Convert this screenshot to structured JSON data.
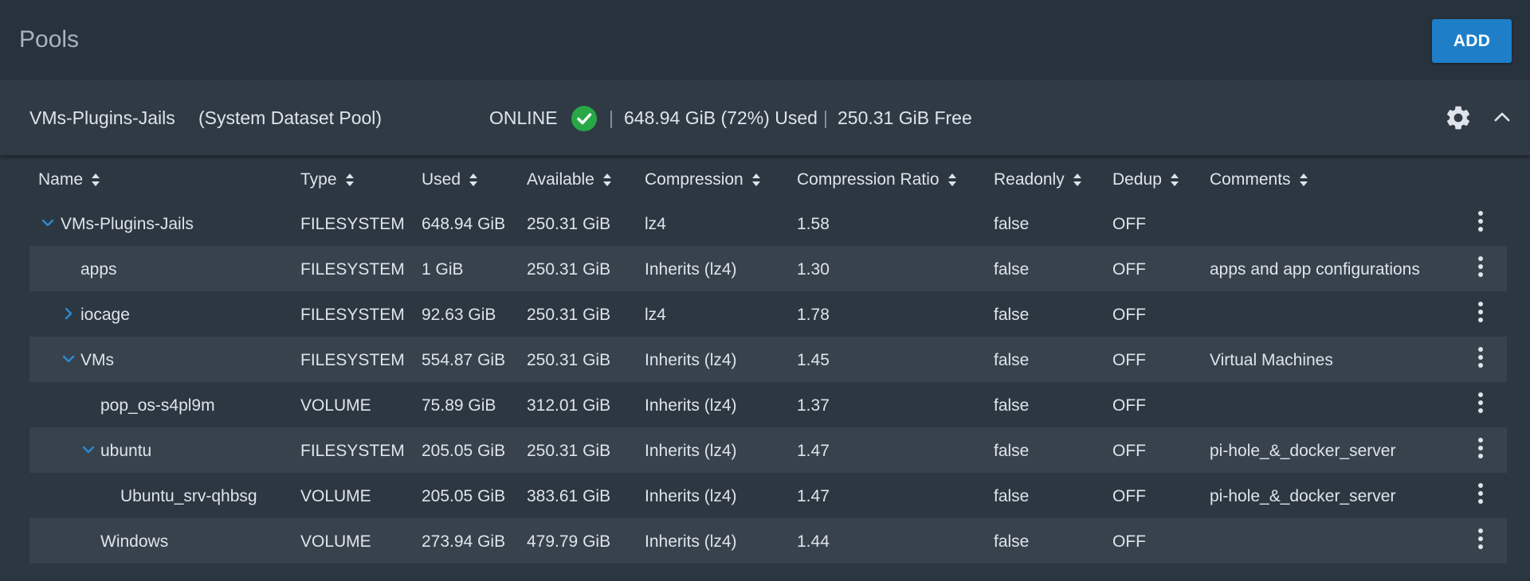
{
  "page": {
    "title": "Pools",
    "add_label": "ADD"
  },
  "pool": {
    "name": "VMs-Plugins-Jails",
    "subtitle": "(System Dataset Pool)",
    "status": "ONLINE",
    "used": "648.94 GiB (72%) Used",
    "free": "250.31 GiB Free",
    "separator": "|",
    "status_color": "#27a745",
    "icons": [
      "check-icon",
      "gear-icon",
      "chevron-up-icon"
    ]
  },
  "table": {
    "columns": [
      "Name",
      "Type",
      "Used",
      "Available",
      "Compression",
      "Compression Ratio",
      "Readonly",
      "Dedup",
      "Comments"
    ],
    "rows": [
      {
        "name": "VMs-Plugins-Jails",
        "type": "FILESYSTEM",
        "used": "648.94 GiB",
        "available": "250.31 GiB",
        "compression": "lz4",
        "ratio": "1.58",
        "readonly": "false",
        "dedup": "OFF",
        "comments": "",
        "expander": "expanded"
      },
      {
        "name": "apps",
        "type": "FILESYSTEM",
        "used": "1 GiB",
        "available": "250.31 GiB",
        "compression": "Inherits (lz4)",
        "ratio": "1.30",
        "readonly": "false",
        "dedup": "OFF",
        "comments": "apps and app configurations",
        "expander": "none"
      },
      {
        "name": "iocage",
        "type": "FILESYSTEM",
        "used": "92.63 GiB",
        "available": "250.31 GiB",
        "compression": "lz4",
        "ratio": "1.78",
        "readonly": "false",
        "dedup": "OFF",
        "comments": "",
        "expander": "collapsed"
      },
      {
        "name": "VMs",
        "type": "FILESYSTEM",
        "used": "554.87 GiB",
        "available": "250.31 GiB",
        "compression": "Inherits (lz4)",
        "ratio": "1.45",
        "readonly": "false",
        "dedup": "OFF",
        "comments": "Virtual Machines",
        "expander": "expanded"
      },
      {
        "name": "pop_os-s4pl9m",
        "type": "VOLUME",
        "used": "75.89 GiB",
        "available": "312.01 GiB",
        "compression": "Inherits (lz4)",
        "ratio": "1.37",
        "readonly": "false",
        "dedup": "OFF",
        "comments": "",
        "expander": "none"
      },
      {
        "name": "ubuntu",
        "type": "FILESYSTEM",
        "used": "205.05 GiB",
        "available": "250.31 GiB",
        "compression": "Inherits (lz4)",
        "ratio": "1.47",
        "readonly": "false",
        "dedup": "OFF",
        "comments": "pi-hole_&_docker_server",
        "expander": "expanded"
      },
      {
        "name": "Ubuntu_srv-qhbsg",
        "type": "VOLUME",
        "used": "205.05 GiB",
        "available": "383.61 GiB",
        "compression": "Inherits (lz4)",
        "ratio": "1.47",
        "readonly": "false",
        "dedup": "OFF",
        "comments": "pi-hole_&_docker_server",
        "expander": "none"
      },
      {
        "name": "Windows",
        "type": "VOLUME",
        "used": "273.94 GiB",
        "available": "479.79 GiB",
        "compression": "Inherits (lz4)",
        "ratio": "1.44",
        "readonly": "false",
        "dedup": "OFF",
        "comments": "",
        "expander": "none"
      }
    ]
  },
  "colors": {
    "accent": "#1e7fc8",
    "expander": "#2a8bd6",
    "row_alt": "#37424d",
    "background": "#2a3440"
  }
}
